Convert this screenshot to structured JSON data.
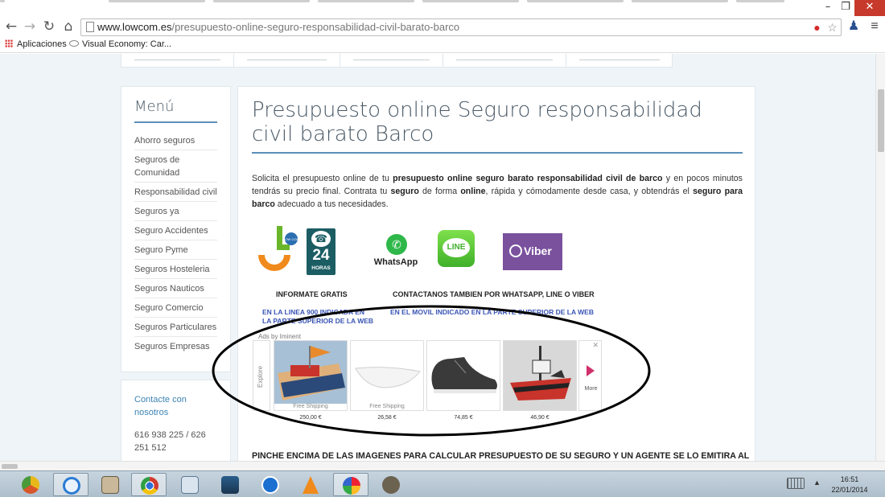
{
  "browser": {
    "url_host": "www.lowcom.es",
    "url_path": "/presupuesto-online-seguro-responsabilidad-civil-barato-barco",
    "window_controls": {
      "minimize": "–",
      "restore": "❐",
      "close": "✕"
    },
    "nav_icons": [
      "back-icon",
      "forward-icon",
      "reload-icon",
      "home-icon"
    ],
    "bookmarks": [
      {
        "label": "Aplicaciones",
        "icon": "apps-grid-icon"
      },
      {
        "label": "Visual Economy: Car...",
        "icon": "visual-economy-icon"
      }
    ]
  },
  "sidebar": {
    "menu_title": "Menú",
    "items": [
      "Ahorro seguros",
      "Seguros de Comunidad",
      "Responsabilidad civil",
      "Seguros ya",
      "Seguro Accidentes",
      "Seguro Pyme",
      "Seguros Hosteleria",
      "Seguros Nauticos",
      "Seguro Comercio",
      "Seguros Particulares",
      "Seguros Empresas"
    ],
    "contact_link": "Contacte con nosotros",
    "contact_phone": "616 938 225 / 626 251 512"
  },
  "main": {
    "title": "Presupuesto online Seguro responsabilidad civil barato Barco",
    "intro": {
      "p1": "Solicita el presupuesto online de tu ",
      "b1": "presupuesto online seguro barato responsabilidad civil  de barco",
      "p2": " y en pocos minutos tendrás su precio final. Contrata tu ",
      "b2": "seguro",
      "p3": " de forma ",
      "b3": "online",
      "p4": ", rápida y cómodamente desde casa, y obtendrás el ",
      "b4": "seguro para barco",
      "p5": " adecuado a tus necesidades."
    },
    "logos": {
      "hours_number": "24",
      "hours_label": "HORAS",
      "whatsapp_label": "WhatsApp",
      "line_label": "LINE",
      "viber_label": "Viber"
    },
    "caption_left": "INFORMATE GRATIS",
    "caption_right": "CONTACTANOS TAMBIEN POR WHATSAPP, LINE O VIBER",
    "sublink_left_1": "EN LA LINEA 900 INDICADA EN",
    "sublink_left_2": "LA PARTE SUPERIOR DE LA WEB",
    "sublink_right": "EN EL MOVIL INDICADO EN LA PARTE SUPERIOR DE LA WEB",
    "ads": {
      "label": "Ads by Iminent",
      "explore": "Explore",
      "more": "More",
      "close": "✕",
      "items": [
        {
          "shipping": "Free Shipping",
          "price": "250,00 €",
          "image": "toy-boat-bed"
        },
        {
          "shipping": "Free Shipping",
          "price": "26,58 €",
          "image": "white-boat-dish"
        },
        {
          "shipping": "",
          "price": "74,85 €",
          "image": "black-boat-shoe"
        },
        {
          "shipping": "",
          "price": "46,90 €",
          "image": "pirate-ship-toy"
        }
      ]
    },
    "bottom_text": "PINCHE ENCIMA DE LAS IMAGENES PARA CALCULAR PRESUPUESTO DE SU SEGURO Y  UN AGENTE SE LO EMITIRA AL"
  },
  "taskbar": {
    "apps": [
      "chrome-canary-icon",
      "internet-explorer-icon",
      "notepad-icon",
      "chrome-icon",
      "calculator-icon",
      "movie-maker-icon",
      "teamviewer-icon",
      "vlc-icon",
      "paint-icon",
      "gimp-icon"
    ],
    "time": "16:51",
    "date": "22/01/2014"
  },
  "colors": {
    "accent_rule": "#5b8fba",
    "link": "#3d84b3",
    "page_bg": "#eef4f7",
    "close_red": "#c7392b",
    "ellipse": "#000000"
  }
}
